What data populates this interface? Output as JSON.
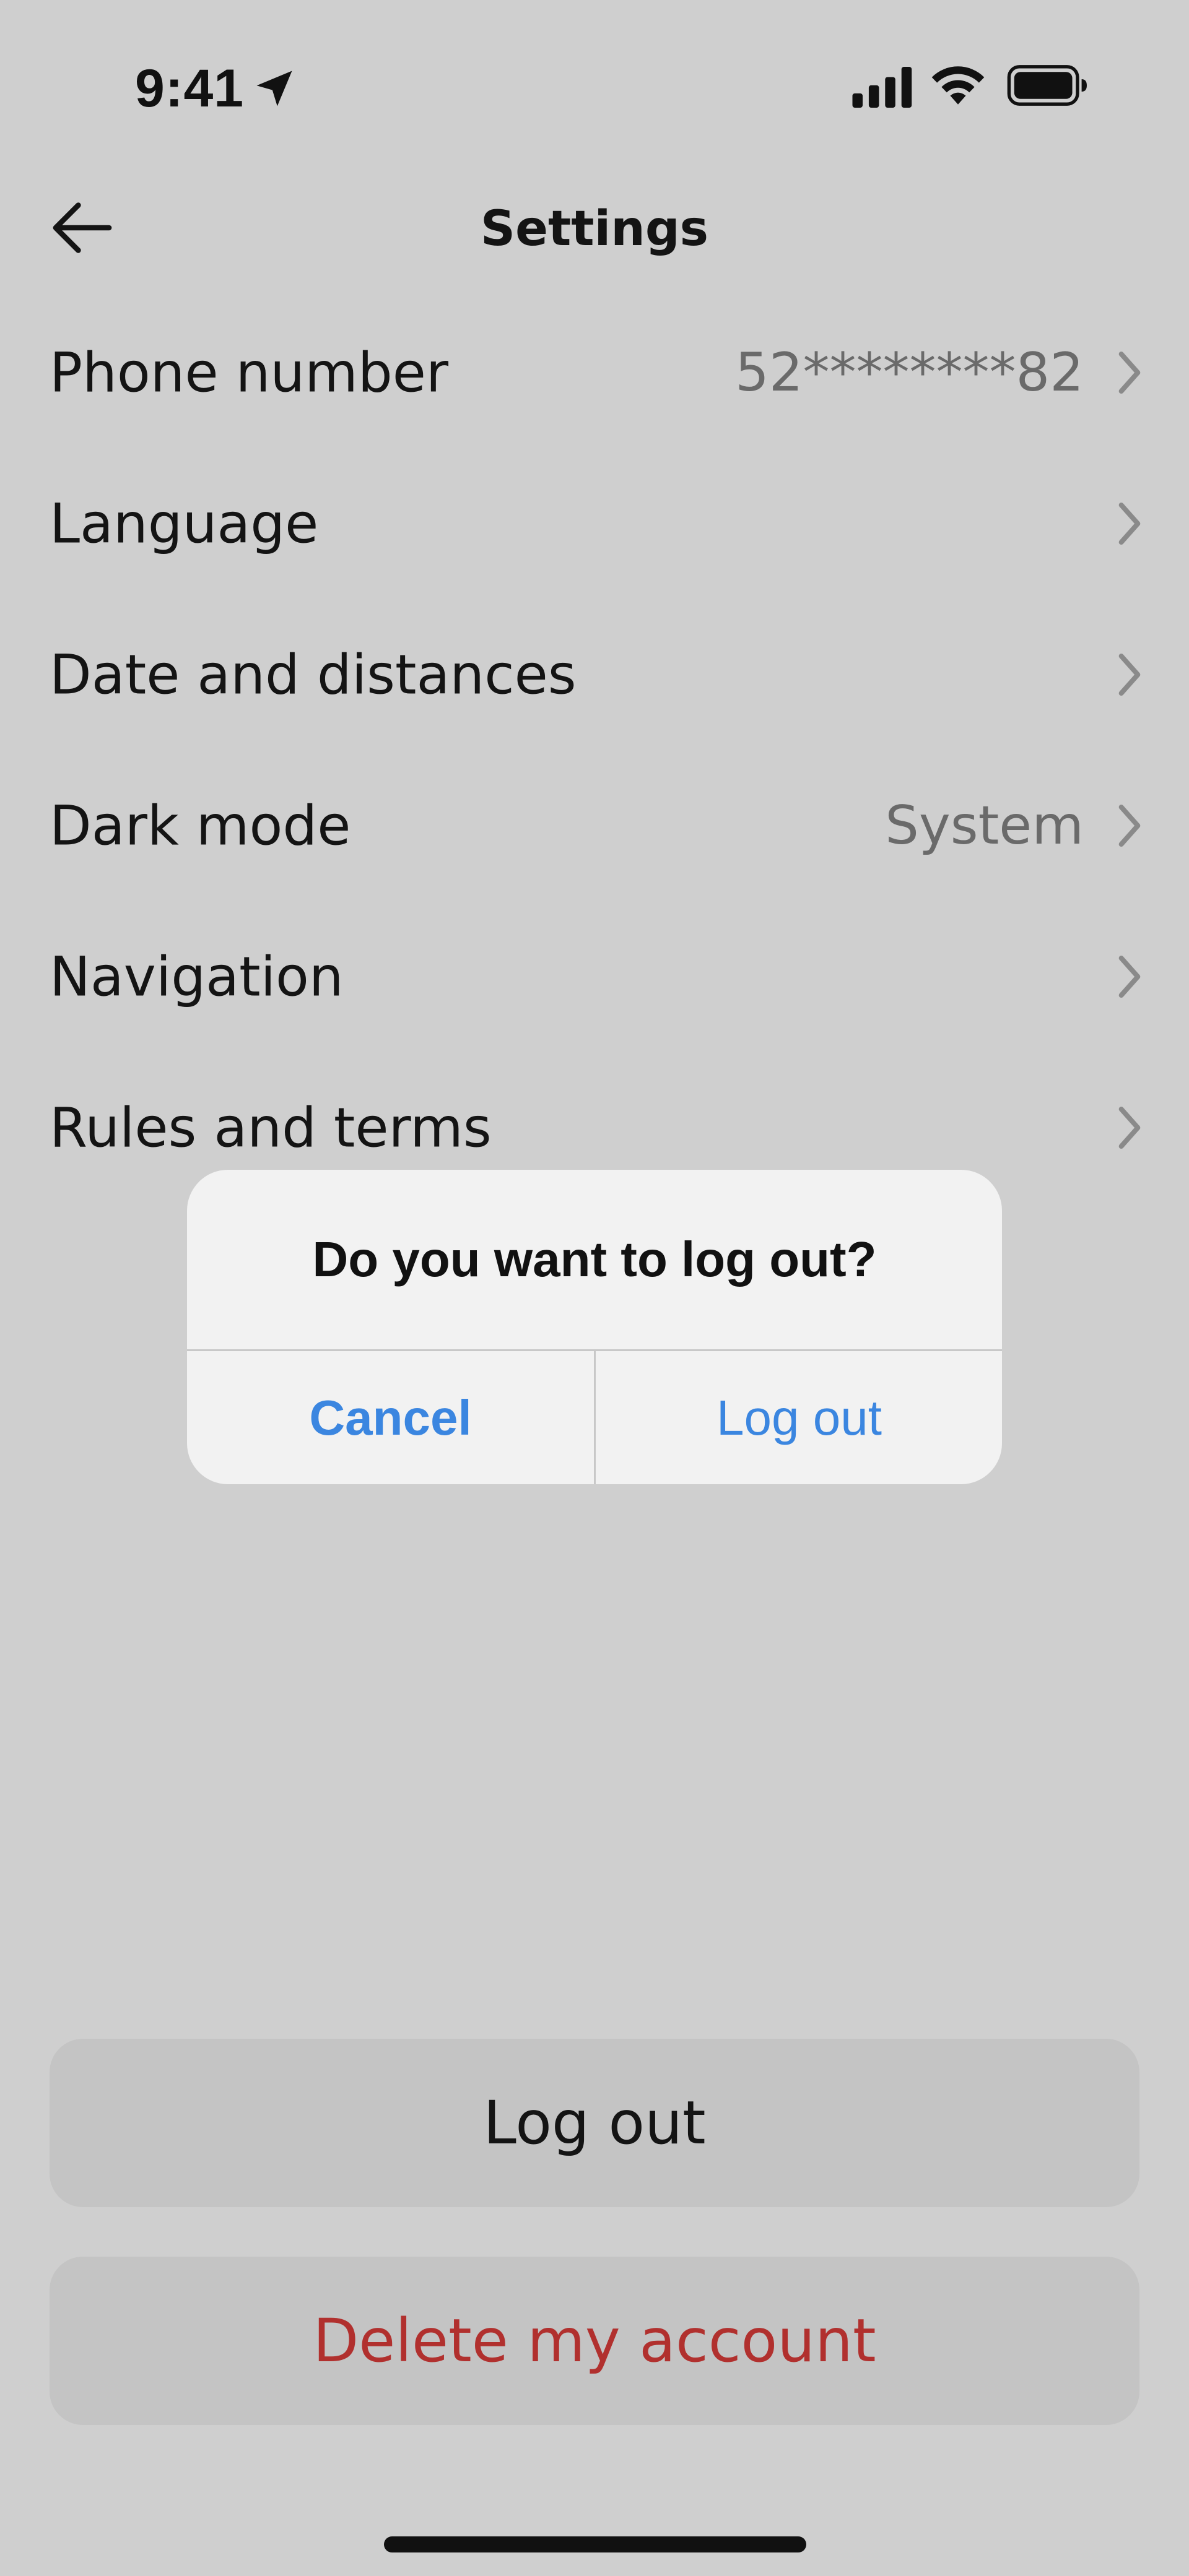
{
  "status_bar": {
    "time": "9:41",
    "icons": [
      "location-arrow-icon",
      "cellular-signal-icon",
      "wifi-icon",
      "battery-icon"
    ]
  },
  "header": {
    "title": "Settings",
    "back_icon": "arrow-left-icon"
  },
  "settings": {
    "items": [
      {
        "label": "Phone number",
        "value": "52********82"
      },
      {
        "label": "Language",
        "value": ""
      },
      {
        "label": "Date and distances",
        "value": ""
      },
      {
        "label": "Dark mode",
        "value": "System"
      },
      {
        "label": "Navigation",
        "value": ""
      },
      {
        "label": "Rules and terms",
        "value": ""
      }
    ]
  },
  "alert": {
    "title": "Do you want to log out?",
    "cancel_label": "Cancel",
    "confirm_label": "Log out"
  },
  "actions": {
    "logout_label": "Log out",
    "delete_label": "Delete my account"
  },
  "colors": {
    "background": "#cfcfcf",
    "alert_background": "#f2f2f2",
    "alert_button_text": "#3b86e0",
    "danger_text": "#b1302e",
    "secondary_text": "#6a6a6a",
    "button_background": "#c4c4c4"
  }
}
